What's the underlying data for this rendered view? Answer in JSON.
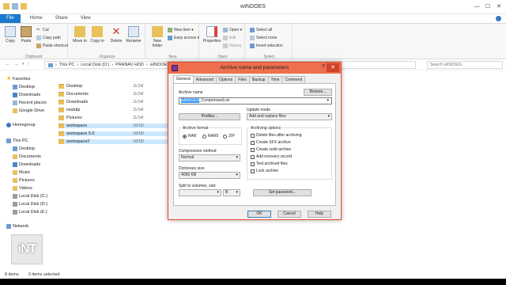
{
  "window": {
    "title": "wINDOES"
  },
  "ribbon_tabs": [
    "File",
    "Home",
    "Share",
    "View"
  ],
  "ribbon": {
    "clipboard": {
      "label": "Clipboard",
      "copy": "Copy",
      "paste": "Paste",
      "cut": "Cut",
      "copy_path": "Copy path",
      "paste_shortcut": "Paste shortcut"
    },
    "organize": {
      "label": "Organize",
      "move_to": "Move to",
      "copy_to": "Copy to",
      "delete": "Delete",
      "rename": "Rename"
    },
    "new": {
      "label": "New",
      "new_folder": "New folder",
      "new_item": "New item ▾",
      "easy_access": "Easy access ▾"
    },
    "open": {
      "label": "Open",
      "properties": "Properties",
      "open": "Open ▾",
      "edit": "Edit",
      "history": "History"
    },
    "select": {
      "label": "Select",
      "select_all": "Select all",
      "select_none": "Select none",
      "invert_selection": "Invert selection"
    }
  },
  "address": {
    "breadcrumbs": [
      "This PC",
      "Local Disk (D:)",
      "PRANAV HDD",
      "wINDOES"
    ],
    "search_placeholder": "Search wINDOES"
  },
  "nav": {
    "favorites": "Favorites",
    "favorites_items": [
      "Desktop",
      "Downloads",
      "Recent places",
      "Google Drive"
    ],
    "homegroup": "Homegroup",
    "this_pc": "This PC",
    "this_pc_items": [
      "Desktop",
      "Documents",
      "Downloads",
      "Music",
      "Pictures",
      "Videos",
      "Local Disk (C:)",
      "Local Disk (D:)",
      "Local Disk (E:)"
    ],
    "network": "Network"
  },
  "files": [
    {
      "name": "Desktop",
      "date": "11/14/",
      "selected": false
    },
    {
      "name": "Documents",
      "date": "11/14/",
      "selected": false
    },
    {
      "name": "Downloads",
      "date": "11/14/",
      "selected": false
    },
    {
      "name": "nssbkp",
      "date": "11/14/",
      "selected": false
    },
    {
      "name": "Pictures",
      "date": "11/14/",
      "selected": false
    },
    {
      "name": "workspace",
      "date": "10/10/",
      "selected": true
    },
    {
      "name": "workspace 5.0",
      "date": "10/18/",
      "selected": true
    },
    {
      "name": "workspace2",
      "date": "10/18/",
      "selected": true
    }
  ],
  "status": {
    "count": "8 items",
    "selected": "3 items selected"
  },
  "logo_text": "iNT",
  "dialog": {
    "title": "Archive name and parameters",
    "help": "?",
    "tabs": [
      "General",
      "Advanced",
      "Options",
      "Files",
      "Backup",
      "Time",
      "Comment"
    ],
    "archive_name_label": "Archive name",
    "browse": "Browse...",
    "archive_name_highlight": "wINDOES",
    "archive_name_rest": "_Compressed.rar",
    "profiles": "Profiles...",
    "update_mode_label": "Update mode",
    "update_mode_value": "Add and replace files",
    "archive_format_label": "Archive format",
    "formats": [
      "RAR",
      "RAR5",
      "ZIP"
    ],
    "selected_format": "RAR",
    "archiving_options_label": "Archiving options",
    "options": [
      "Delete files after archiving",
      "Create SFX archive",
      "Create solid archive",
      "Add recovery record",
      "Test archived files",
      "Lock archive"
    ],
    "compression_method_label": "Compression method",
    "compression_method_value": "Normal",
    "dictionary_size_label": "Dictionary size",
    "dictionary_size_value": "4096 KB",
    "split_label": "Split to volumes, size",
    "split_unit": "B",
    "set_password": "Set password...",
    "ok": "OK",
    "cancel": "Cancel",
    "help_button": "Help"
  }
}
